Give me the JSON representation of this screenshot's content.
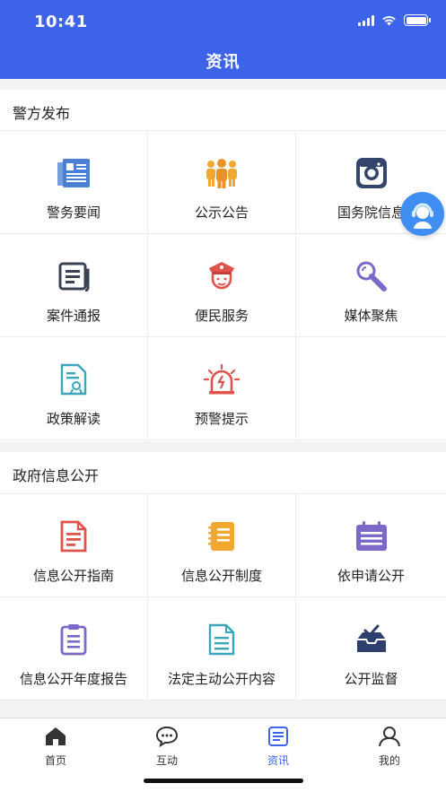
{
  "status_bar": {
    "time": "10:41"
  },
  "header": {
    "title": "资讯"
  },
  "police_section": {
    "title": "警方发布",
    "items": [
      {
        "label": "警务要闻",
        "icon": "news-document-icon",
        "color": "#4a7fd4"
      },
      {
        "label": "公示公告",
        "icon": "group-people-icon",
        "color": "#f0a830"
      },
      {
        "label": "国务院信息",
        "icon": "camera-icon",
        "color": "#34446a"
      },
      {
        "label": "案件通报",
        "icon": "report-icon",
        "color": "#3b4254"
      },
      {
        "label": "便民服务",
        "icon": "police-officer-icon",
        "color": "#e0534d"
      },
      {
        "label": "媒体聚焦",
        "icon": "microphone-icon",
        "color": "#7b68c8"
      },
      {
        "label": "政策解读",
        "icon": "policy-document-icon",
        "color": "#3aa6b9"
      },
      {
        "label": "预警提示",
        "icon": "alarm-light-icon",
        "color": "#e0534d"
      }
    ]
  },
  "gov_section": {
    "title": "政府信息公开",
    "items": [
      {
        "label": "信息公开指南",
        "icon": "guide-document-icon",
        "color": "#e0534d"
      },
      {
        "label": "信息公开制度",
        "icon": "system-book-icon",
        "color": "#f0a830"
      },
      {
        "label": "依申请公开",
        "icon": "calendar-list-icon",
        "color": "#7b68c8"
      },
      {
        "label": "信息公开年度报告",
        "icon": "clipboard-icon",
        "color": "#7b68c8"
      },
      {
        "label": "法定主动公开内容",
        "icon": "content-document-icon",
        "color": "#3aa6b9"
      },
      {
        "label": "公开监督",
        "icon": "inbox-check-icon",
        "color": "#2e3f6e"
      }
    ]
  },
  "tabbar": {
    "tabs": [
      {
        "label": "首页",
        "icon": "home-icon"
      },
      {
        "label": "互动",
        "icon": "chat-icon"
      },
      {
        "label": "资讯",
        "icon": "news-icon",
        "active": true
      },
      {
        "label": "我的",
        "icon": "user-icon"
      }
    ]
  },
  "colors": {
    "brand": "#3d63ea",
    "background": "#f2f3f5"
  }
}
